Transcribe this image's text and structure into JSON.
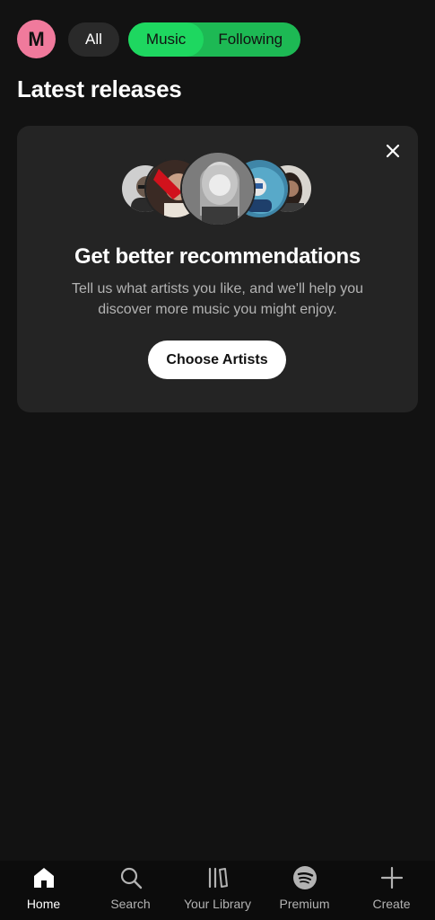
{
  "profile": {
    "initial": "M",
    "color": "#f07a9c"
  },
  "filters": {
    "all": "All",
    "music": "Music",
    "following": "Following",
    "accent": "#1ed760"
  },
  "section": {
    "title": "Latest releases"
  },
  "recommendation_card": {
    "title": "Get better recommendations",
    "description": "Tell us what artists you like, and we'll help you discover more music you might enjoy.",
    "button": "Choose Artists",
    "close_icon": "close-icon",
    "artist_images": [
      "artist-1",
      "artist-2",
      "artist-3",
      "artist-4",
      "artist-5"
    ]
  },
  "bottom_nav": {
    "items": [
      {
        "label": "Home",
        "icon": "home-icon",
        "active": true
      },
      {
        "label": "Search",
        "icon": "search-icon",
        "active": false
      },
      {
        "label": "Your Library",
        "icon": "library-icon",
        "active": false
      },
      {
        "label": "Premium",
        "icon": "spotify-icon",
        "active": false
      },
      {
        "label": "Create",
        "icon": "plus-icon",
        "active": false
      }
    ]
  }
}
